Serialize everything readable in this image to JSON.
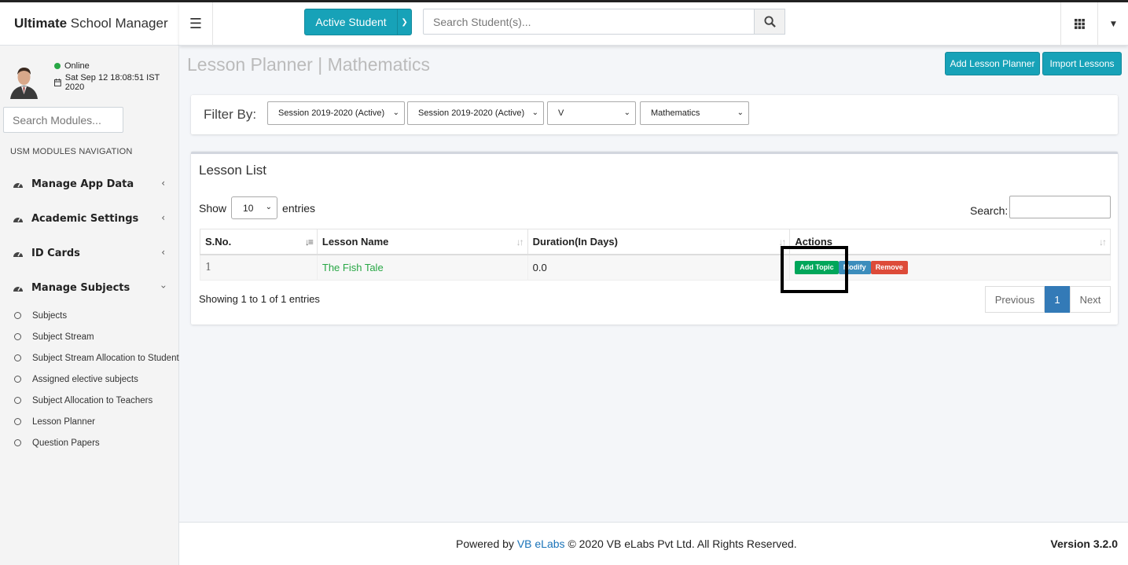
{
  "brand": {
    "bold": "Ultimate",
    "rest": " School Manager"
  },
  "topbar": {
    "active_student_label": "Active Student",
    "search_placeholder": "Search Student(s)..."
  },
  "sidebar": {
    "status": "Online",
    "datetime": "Sat Sep 12 18:08:51 IST 2020",
    "module_search_placeholder": "Search Modules...",
    "nav_header": "USM MODULES NAVIGATION",
    "items": [
      {
        "label": "Manage App Data"
      },
      {
        "label": "Academic Settings"
      },
      {
        "label": "ID Cards"
      },
      {
        "label": "Manage Subjects"
      }
    ],
    "subitems": [
      {
        "label": "Subjects"
      },
      {
        "label": "Subject Stream"
      },
      {
        "label": "Subject Stream Allocation to Students"
      },
      {
        "label": "Assigned elective subjects"
      },
      {
        "label": "Subject Allocation to Teachers"
      },
      {
        "label": "Lesson Planner"
      },
      {
        "label": "Question Papers"
      }
    ]
  },
  "page": {
    "title": "Lesson Planner | Mathematics",
    "add_button": "Add Lesson Planner",
    "import_button": "Import Lessons"
  },
  "filter": {
    "label": "Filter By:",
    "session1": "Session 2019-2020 (Active)",
    "session2": "Session 2019-2020 (Active)",
    "class": "V",
    "subject": "Mathematics"
  },
  "lesson_list": {
    "title": "Lesson List",
    "show": "Show",
    "entries_count": "10",
    "entries": "entries",
    "search_label": "Search:",
    "columns": [
      "S.No.",
      "Lesson Name",
      "Duration(In Days)",
      "Actions"
    ],
    "rows": [
      {
        "sno": "1",
        "name": "The Fish Tale",
        "duration": "0.0"
      }
    ],
    "actions": {
      "add_topic": "Add Topic",
      "modify": "Modify",
      "remove": "Remove"
    },
    "showing": "Showing 1 to 1 of 1 entries",
    "pager": {
      "previous": "Previous",
      "current": "1",
      "next": "Next"
    }
  },
  "footer": {
    "powered_by": "Powered by",
    "company": "VB eLabs",
    "copyright": "© 2020 VB eLabs Pvt Ltd. All Rights Reserved.",
    "version": "Version 3.2.0"
  },
  "colors": {
    "accent": "#17a2b8",
    "success": "#28a745",
    "info": "#3c8dbc",
    "danger": "#dd4b39",
    "pager_active": "#337ab7"
  }
}
